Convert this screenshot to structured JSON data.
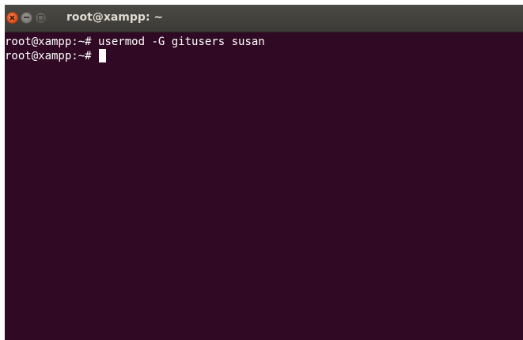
{
  "window": {
    "title": "root@xampp: ~",
    "controls": {
      "close": "close-icon",
      "minimize": "minimize-icon",
      "maximize": "maximize-icon"
    }
  },
  "terminal": {
    "lines": [
      {
        "prompt": "root@xampp:~# ",
        "command": "usermod -G gitusers susan"
      },
      {
        "prompt": "root@xampp:~# ",
        "command": ""
      }
    ],
    "colors": {
      "background": "#300a24",
      "foreground": "#ffffff"
    }
  }
}
